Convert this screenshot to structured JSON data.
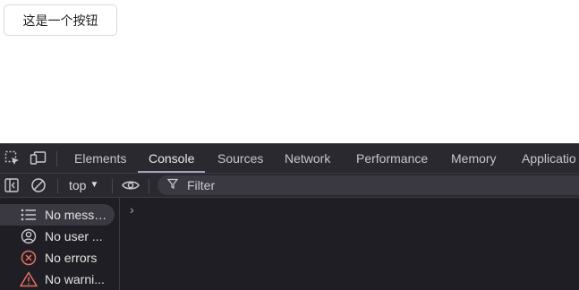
{
  "page": {
    "button_label": "这是一个按钮"
  },
  "devtools": {
    "tabs": [
      {
        "label": "Elements",
        "active": false
      },
      {
        "label": "Console",
        "active": true
      },
      {
        "label": "Sources",
        "active": false
      },
      {
        "label": "Network",
        "active": false
      },
      {
        "label": "Performance",
        "active": false
      },
      {
        "label": "Memory",
        "active": false
      },
      {
        "label": "Applicatio",
        "active": false
      }
    ],
    "toolbar": {
      "context": "top",
      "filter_placeholder": "Filter"
    },
    "sidebar": {
      "items": [
        {
          "label": "No messa...",
          "icon": "list-icon",
          "selected": true
        },
        {
          "label": "No user ...",
          "icon": "user-icon",
          "selected": false
        },
        {
          "label": "No errors",
          "icon": "error-icon",
          "selected": false
        },
        {
          "label": "No warni...",
          "icon": "warning-icon",
          "selected": false
        }
      ]
    },
    "console": {
      "prompt": "›"
    }
  },
  "colors": {
    "devtools_bg": "#1f1e24",
    "toolbar_bg": "#2a2930",
    "error": "#e46f5e",
    "warning": "#e46f5e",
    "active_tab_underline": "#a7a3bd"
  }
}
